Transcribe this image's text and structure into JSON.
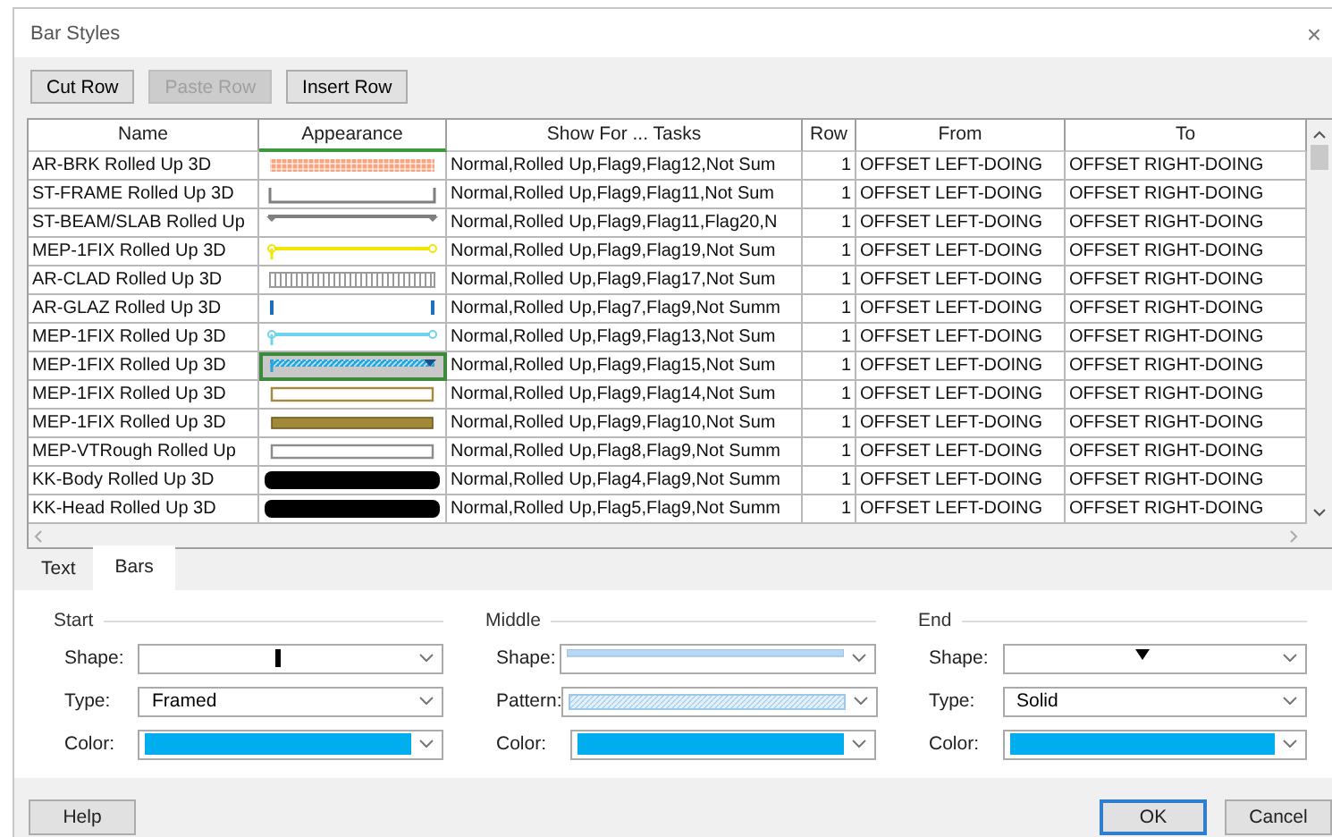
{
  "window": {
    "title": "Bar Styles",
    "close": "×"
  },
  "toolbar": [
    {
      "label": "Cut Row",
      "disabled": false
    },
    {
      "label": "Paste Row",
      "disabled": true
    },
    {
      "label": "Insert Row",
      "disabled": false
    }
  ],
  "table": {
    "columns": [
      "Name",
      "Appearance",
      "Show For ... Tasks",
      "Row",
      "From",
      "To"
    ],
    "rows": [
      {
        "name": "AR-BRK Rolled Up 3D",
        "appearance": {
          "kind": "hatched",
          "color": "#f4a582"
        },
        "show_for": "Normal,Rolled Up,Flag9,Flag12,Not Sum",
        "row": "1",
        "from": "OFFSET LEFT-DOING",
        "to": "OFFSET RIGHT-DOING",
        "selected": false
      },
      {
        "name": "ST-FRAME Rolled Up 3D",
        "appearance": {
          "kind": "bracket",
          "color": "#7f7f7f"
        },
        "show_for": "Normal,Rolled Up,Flag9,Flag11,Not Sum",
        "row": "1",
        "from": "OFFSET LEFT-DOING",
        "to": "OFFSET RIGHT-DOING",
        "selected": false
      },
      {
        "name": "ST-BEAM/SLAB Rolled Up",
        "appearance": {
          "kind": "capped",
          "color": "#7f7f7f"
        },
        "show_for": "Normal,Rolled Up,Flag9,Flag11,Flag20,N",
        "row": "1",
        "from": "OFFSET LEFT-DOING",
        "to": "OFFSET RIGHT-DOING",
        "selected": false
      },
      {
        "name": "MEP-1FIX Rolled Up 3D",
        "appearance": {
          "kind": "dotted",
          "color": "#f2e600"
        },
        "show_for": "Normal,Rolled Up,Flag9,Flag19,Not Sum",
        "row": "1",
        "from": "OFFSET LEFT-DOING",
        "to": "OFFSET RIGHT-DOING",
        "selected": false
      },
      {
        "name": "AR-CLAD Rolled Up 3D",
        "appearance": {
          "kind": "striped",
          "color": "#9a9a9a"
        },
        "show_for": "Normal,Rolled Up,Flag9,Flag17,Not Sum",
        "row": "1",
        "from": "OFFSET LEFT-DOING",
        "to": "OFFSET RIGHT-DOING",
        "selected": false
      },
      {
        "name": "AR-GLAZ Rolled Up 3D",
        "appearance": {
          "kind": "ends",
          "color": "#1f6fbf"
        },
        "show_for": "Normal,Rolled Up,Flag7,Flag9,Not Summ",
        "row": "1",
        "from": "OFFSET LEFT-DOING",
        "to": "OFFSET RIGHT-DOING",
        "selected": false
      },
      {
        "name": "MEP-1FIX Rolled Up 3D",
        "appearance": {
          "kind": "dotted",
          "color": "#6fd3ee"
        },
        "show_for": "Normal,Rolled Up,Flag9,Flag13,Not Sum",
        "row": "1",
        "from": "OFFSET LEFT-DOING",
        "to": "OFFSET RIGHT-DOING",
        "selected": false
      },
      {
        "name": "MEP-1FIX Rolled Up 3D",
        "appearance": {
          "kind": "arrow",
          "color": "#29a3d9"
        },
        "show_for": "Normal,Rolled Up,Flag9,Flag15,Not Sum",
        "row": "1",
        "from": "OFFSET LEFT-DOING",
        "to": "OFFSET RIGHT-DOING",
        "selected": true
      },
      {
        "name": "MEP-1FIX Rolled Up 3D",
        "appearance": {
          "kind": "framed",
          "color": "#a58a3c"
        },
        "show_for": "Normal,Rolled Up,Flag9,Flag14,Not Sum",
        "row": "1",
        "from": "OFFSET LEFT-DOING",
        "to": "OFFSET RIGHT-DOING",
        "selected": false
      },
      {
        "name": "MEP-1FIX Rolled Up 3D",
        "appearance": {
          "kind": "filled",
          "color": "#a08a3a"
        },
        "show_for": "Normal,Rolled Up,Flag9,Flag10,Not Sum",
        "row": "1",
        "from": "OFFSET LEFT-DOING",
        "to": "OFFSET RIGHT-DOING",
        "selected": false
      },
      {
        "name": "MEP-VTRough Rolled Up",
        "appearance": {
          "kind": "framed",
          "color": "#8c8c8c"
        },
        "show_for": "Normal,Rolled Up,Flag8,Flag9,Not Summ",
        "row": "1",
        "from": "OFFSET LEFT-DOING",
        "to": "OFFSET RIGHT-DOING",
        "selected": false
      },
      {
        "name": "KK-Body Rolled Up 3D",
        "appearance": {
          "kind": "rounded",
          "color": "#000000"
        },
        "show_for": "Normal,Rolled Up,Flag4,Flag9,Not Summ",
        "row": "1",
        "from": "OFFSET LEFT-DOING",
        "to": "OFFSET RIGHT-DOING",
        "selected": false
      },
      {
        "name": "KK-Head Rolled Up 3D",
        "appearance": {
          "kind": "rounded",
          "color": "#000000"
        },
        "show_for": "Normal,Rolled Up,Flag5,Flag9,Not Summ",
        "row": "1",
        "from": "OFFSET LEFT-DOING",
        "to": "OFFSET RIGHT-DOING",
        "selected": false
      }
    ]
  },
  "tabs": [
    {
      "label": "Text",
      "selected": false
    },
    {
      "label": "Bars",
      "selected": true
    }
  ],
  "groups": [
    {
      "title": "Start",
      "fields": [
        {
          "label": "Shape:",
          "kind": "shape-tick"
        },
        {
          "label": "Type:",
          "kind": "text",
          "value": "Framed"
        },
        {
          "label": "Color:",
          "kind": "color",
          "color": "#00aeef"
        }
      ]
    },
    {
      "title": "Middle",
      "fields": [
        {
          "label": "Shape:",
          "kind": "shape-band"
        },
        {
          "label": "Pattern:",
          "kind": "pattern-hatch"
        },
        {
          "label": "Color:",
          "kind": "color",
          "color": "#00aeef"
        }
      ]
    },
    {
      "title": "End",
      "fields": [
        {
          "label": "Shape:",
          "kind": "shape-triangle"
        },
        {
          "label": "Type:",
          "kind": "text",
          "value": "Solid"
        },
        {
          "label": "Color:",
          "kind": "color",
          "color": "#00aeef"
        }
      ]
    }
  ],
  "buttons": [
    {
      "label": "Help",
      "default": false
    },
    {
      "label": "OK",
      "default": true
    },
    {
      "label": "Cancel",
      "default": false
    }
  ]
}
